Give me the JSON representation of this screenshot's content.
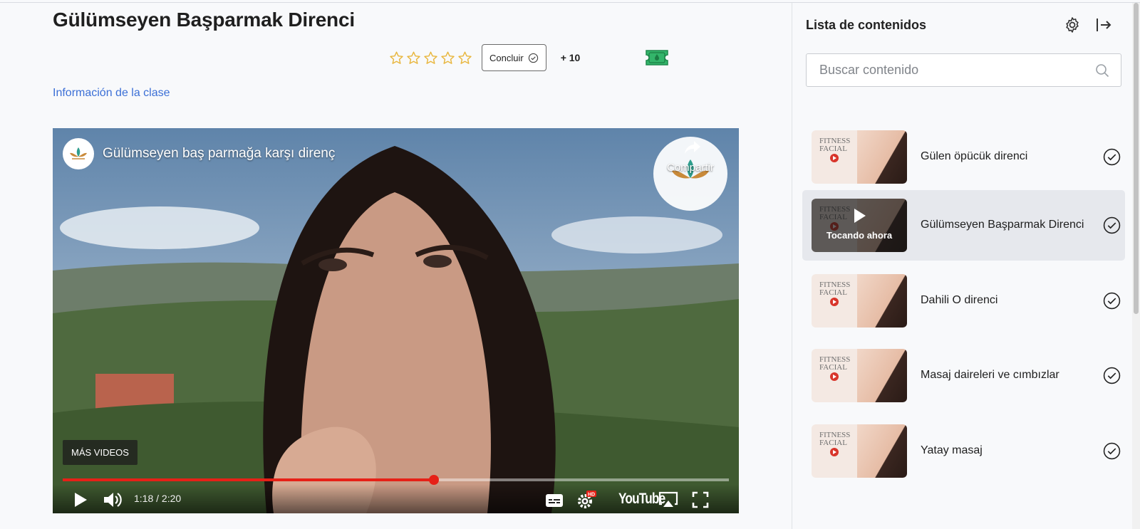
{
  "page": {
    "title": "Gülümseyen Başparmak Direnci",
    "rating_stars": 5,
    "complete_button": "Concluir",
    "points": "+ 10",
    "class_info_link": "Información de la clase"
  },
  "video": {
    "title": "Gülümseyen baş parmağa karşı direnç",
    "share_label": "Compartir",
    "more_videos": "MÁS VIDEOS",
    "time": "1:18 / 2:20",
    "progress_fraction": 0.557,
    "provider": "YouTube",
    "hd_badge": "HD",
    "accent_color": "#e62117"
  },
  "sidebar": {
    "title": "Lista de contenidos",
    "search_placeholder": "Buscar contenido",
    "now_playing_label": "Tocando ahora",
    "thumb_text": [
      "FITNESS",
      "FACIAL"
    ],
    "items": [
      {
        "label": "Gülen öpücük direnci",
        "active": false
      },
      {
        "label": "Gülümseyen Başparmak Direnci",
        "active": true
      },
      {
        "label": "Dahili O direnci",
        "active": false
      },
      {
        "label": "Masaj daireleri ve cımbızlar",
        "active": false
      },
      {
        "label": "Yatay masaj",
        "active": false
      }
    ]
  }
}
